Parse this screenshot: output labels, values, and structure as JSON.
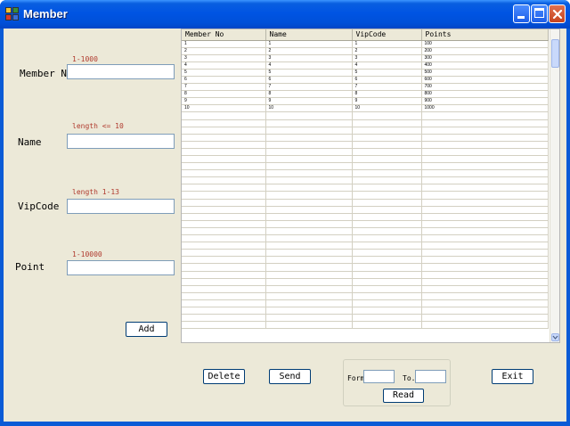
{
  "window": {
    "title": "Member"
  },
  "form": {
    "member_no": {
      "label": "Member NU",
      "hint": "1-1000",
      "value": ""
    },
    "name": {
      "label": "Name",
      "hint": "length <= 10",
      "value": ""
    },
    "vipcode": {
      "label": "VipCode",
      "hint": "length 1-13",
      "value": ""
    },
    "point": {
      "label": "Point",
      "hint": "1-10000",
      "value": ""
    },
    "add_label": "Add"
  },
  "grid": {
    "columns": [
      "Member No",
      "Name",
      "VipCode",
      "Points"
    ],
    "rows": [
      [
        "1",
        "1",
        "1",
        "100"
      ],
      [
        "2",
        "2",
        "2",
        "200"
      ],
      [
        "3",
        "3",
        "3",
        "300"
      ],
      [
        "4",
        "4",
        "4",
        "400"
      ],
      [
        "5",
        "5",
        "5",
        "500"
      ],
      [
        "6",
        "6",
        "6",
        "600"
      ],
      [
        "7",
        "7",
        "7",
        "700"
      ],
      [
        "8",
        "8",
        "8",
        "800"
      ],
      [
        "9",
        "9",
        "9",
        "900"
      ],
      [
        "10",
        "10",
        "10",
        "1000"
      ]
    ],
    "empty_rows": 30
  },
  "actions": {
    "delete_label": "Delete",
    "send_label": "Send",
    "exit_label": "Exit"
  },
  "range": {
    "from_label": "Form",
    "to_label": "To.",
    "read_label": "Read",
    "from_value": "",
    "to_value": ""
  },
  "icons": {
    "app": "app-icon",
    "minimize": "minimize-icon",
    "maximize": "maximize-icon",
    "close": "close-icon"
  },
  "colors": {
    "titlebar": "#0054e3",
    "hint_text": "#b03a2e",
    "client_bg": "#ece9d8"
  }
}
